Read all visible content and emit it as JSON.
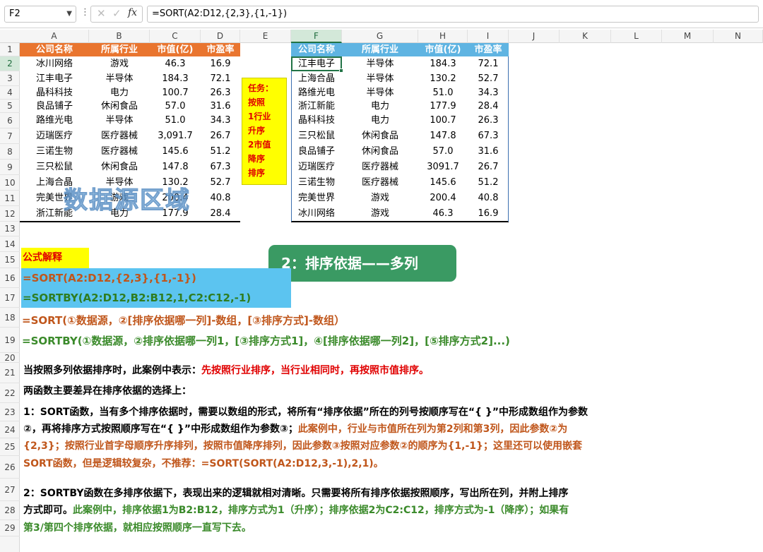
{
  "formula_bar": {
    "name_box": "F2",
    "formula": "=SORT(A2:D12,{2,3},{1,-1})",
    "fx_label": "fx"
  },
  "columns": [
    "A",
    "B",
    "C",
    "D",
    "E",
    "F",
    "G",
    "H",
    "I",
    "J",
    "K",
    "L",
    "M",
    "N"
  ],
  "rows": [
    "1",
    "2",
    "3",
    "4",
    "5",
    "6",
    "7",
    "8",
    "9",
    "10",
    "11",
    "12",
    "13",
    "14",
    "15",
    "16",
    "17",
    "18",
    "19",
    "20",
    "21",
    "22",
    "23",
    "24",
    "25",
    "26",
    "27",
    "28",
    "29"
  ],
  "source_table": {
    "headers": [
      "公司名称",
      "所属行业",
      "市值(亿)",
      "市盈率"
    ],
    "rows": [
      [
        "冰川网络",
        "游戏",
        "46.3",
        "16.9"
      ],
      [
        "江丰电子",
        "半导体",
        "184.3",
        "72.1"
      ],
      [
        "晶科科技",
        "电力",
        "100.7",
        "26.3"
      ],
      [
        "良品铺子",
        "休闲食品",
        "57.0",
        "31.6"
      ],
      [
        "路维光电",
        "半导体",
        "51.0",
        "34.3"
      ],
      [
        "迈瑞医疗",
        "医疗器械",
        "3,091.7",
        "26.7"
      ],
      [
        "三诺生物",
        "医疗器械",
        "145.6",
        "51.2"
      ],
      [
        "三只松鼠",
        "休闲食品",
        "147.8",
        "67.3"
      ],
      [
        "上海合晶",
        "半导体",
        "130.2",
        "52.7"
      ],
      [
        "完美世界",
        "游戏",
        "200.4",
        "40.8"
      ],
      [
        "浙江新能",
        "电力",
        "177.9",
        "28.4"
      ]
    ],
    "watermark": "数据源区域"
  },
  "task_note": {
    "lines": [
      "任务：",
      "按照",
      "1行业",
      "升序",
      "2市值",
      "降序",
      "排序"
    ]
  },
  "result_table": {
    "headers": [
      "公司名称",
      "所属行业",
      "市值(亿)",
      "市盈率"
    ],
    "rows": [
      [
        "江丰电子",
        "半导体",
        "184.3",
        "72.1"
      ],
      [
        "上海合晶",
        "半导体",
        "130.2",
        "52.7"
      ],
      [
        "路维光电",
        "半导体",
        "51.0",
        "34.3"
      ],
      [
        "浙江新能",
        "电力",
        "177.9",
        "28.4"
      ],
      [
        "晶科科技",
        "电力",
        "100.7",
        "26.3"
      ],
      [
        "三只松鼠",
        "休闲食品",
        "147.8",
        "67.3"
      ],
      [
        "良品铺子",
        "休闲食品",
        "57.0",
        "31.6"
      ],
      [
        "迈瑞医疗",
        "医疗器械",
        "3091.7",
        "26.7"
      ],
      [
        "三诺生物",
        "医疗器械",
        "145.6",
        "51.2"
      ],
      [
        "完美世界",
        "游戏",
        "200.4",
        "40.8"
      ],
      [
        "冰川网络",
        "游戏",
        "46.3",
        "16.9"
      ]
    ]
  },
  "banner": "2：排序依据——多列",
  "formula_explain": {
    "title": "公式解释",
    "sort_formula": "=SORT(A2:D12,{2,3},{1,-1})",
    "sortby_formula": "=SORTBY(A2:D12,B2:B12,1,C2:C12,-1)",
    "sort_syntax": "=SORT(①数据源，②[排序依据哪一列]-数组，[③排序方式]-数组）",
    "sortby_syntax": "=SORTBY(①数据源，②排序依据哪一列1，[③排序方式1]，④[排序依据哪一列2]，[⑤排序方式2]...)"
  },
  "notes": {
    "r21_a": "当按照多列依据排序时，此案例中表示：",
    "r21_b": "先按照行业排序，当行业相同时，再按照市值排序。",
    "r22": "两函数主要差异在排序依据的选择上：",
    "r23": "1：SORT函数，当有多个排序依据时，需要以数组的形式，将所有“排序依据”所在的列号按顺序写在“{ }”中形成数组作为参数",
    "r24_a": "②，再将排序方式按照顺序写在“{ }”中形成数组作为参数③；",
    "r24_b": "此案例中，行业与市值所在列为第2列和第3列，因此参数②为",
    "r25": "{2,3}；按照行业首字母顺序升序排列，按照市值降序排列，因此参数③按照对应参数②的顺序为{1,-1}；这里还可以使用嵌套",
    "r26": "SORT函数，但是逻辑较复杂，不推荐：=SORT(SORT(A2:D12,3,-1),2,1)。",
    "r27": "2：SORTBY函数在多排序依据下，表现出来的逻辑就相对清晰。只需要将所有排序依据按照顺序，写出所在列，并附上排序",
    "r28_a": "方式即可。",
    "r28_b": "此案例中，排序依据1为B2:B12，排序方式为1（升序）；排序依据2为C2:C12，排序方式为-1（降序）；如果有",
    "r29": "第3/第四个排序依据，就相应按照顺序一直写下去。"
  },
  "colors": {
    "orange_header": "#e9752f",
    "blue_header": "#5fb4e2",
    "green_banner": "#3a9a63",
    "yellow_note": "#ffff00",
    "formula_bg": "#5cc4f0",
    "red_text": "#e00000",
    "brown_text": "#c0561b",
    "green_text": "#3a8a2a"
  }
}
